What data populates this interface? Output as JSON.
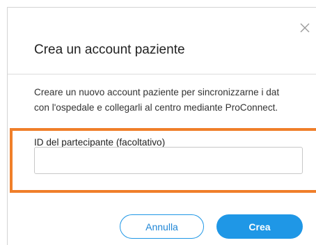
{
  "dialog": {
    "title": "Crea un account paziente",
    "close_icon": "close-icon",
    "description_line1": "Creare un nuovo account paziente per sincronizzarne i dat",
    "description_line2": "con l'ospedale e collegarli al centro mediante ProConnect.",
    "field": {
      "label": "ID del partecipante (facoltativo)",
      "value": "",
      "placeholder": ""
    },
    "buttons": {
      "cancel_label": "Annulla",
      "create_label": "Crea"
    }
  },
  "colors": {
    "accent": "#1f97e6",
    "highlight": "#f07f2a"
  }
}
